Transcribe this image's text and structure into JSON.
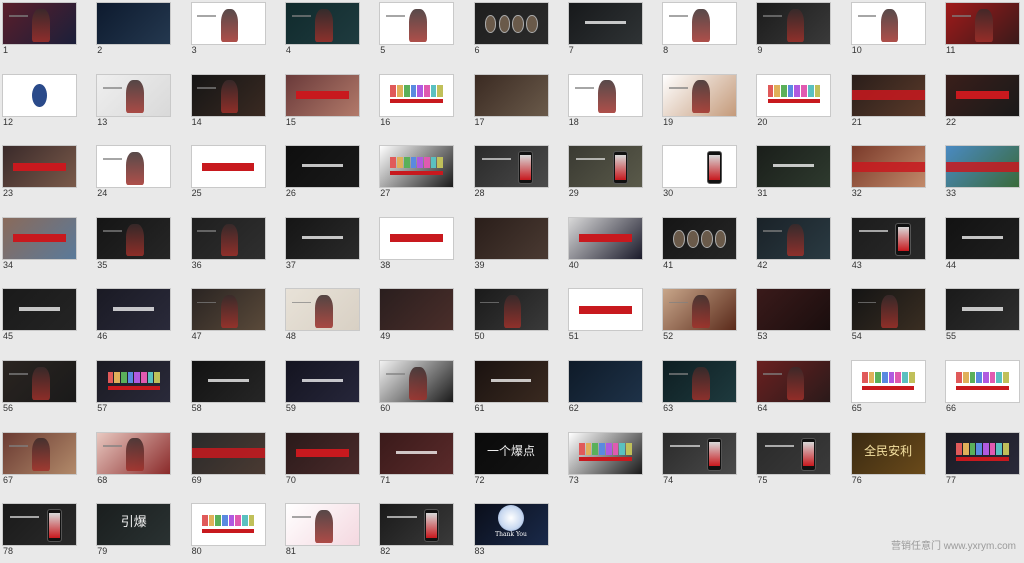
{
  "watermark": "营销任意门 www.yxrym.com",
  "slides": [
    {
      "n": "1",
      "c1": "#5a1e2a",
      "c2": "#1b1f3a",
      "ov": "figure"
    },
    {
      "n": "2",
      "c1": "#0d1a2e",
      "c2": "#24384f",
      "ov": "none"
    },
    {
      "n": "3",
      "c1": "#ffffff",
      "c2": "#ffffff",
      "ov": "figure"
    },
    {
      "n": "4",
      "c1": "#102a2c",
      "c2": "#1f3b3f",
      "ov": "figure"
    },
    {
      "n": "5",
      "c1": "#ffffff",
      "c2": "#ffffff",
      "ov": "figure"
    },
    {
      "n": "6",
      "c1": "#1e1e1e",
      "c2": "#2b2b2b",
      "ov": "circles"
    },
    {
      "n": "7",
      "c1": "#17191b",
      "c2": "#2f3335",
      "ov": "title"
    },
    {
      "n": "8",
      "c1": "#ffffff",
      "c2": "#ffffff",
      "ov": "figure"
    },
    {
      "n": "9",
      "c1": "#1b1b1b",
      "c2": "#3a3a3a",
      "ov": "figure"
    },
    {
      "n": "10",
      "c1": "#ffffff",
      "c2": "#ffffff",
      "ov": "figure"
    },
    {
      "n": "11",
      "c1": "#a01a1a",
      "c2": "#3a1a1a",
      "ov": "figure"
    },
    {
      "n": "12",
      "c1": "#ffffff",
      "c2": "#ffffff",
      "ov": "badge"
    },
    {
      "n": "13",
      "c1": "#efefef",
      "c2": "#d9d9d9",
      "ov": "figure"
    },
    {
      "n": "14",
      "c1": "#151515",
      "c2": "#3a2a22",
      "ov": "figure"
    },
    {
      "n": "15",
      "c1": "#6a3a3a",
      "c2": "#b27a6a",
      "ov": "bar"
    },
    {
      "n": "16",
      "c1": "#ffffff",
      "c2": "#ffffff",
      "ov": "row"
    },
    {
      "n": "17",
      "c1": "#3a2a22",
      "c2": "#6a5a4a",
      "ov": "none"
    },
    {
      "n": "18",
      "c1": "#ffffff",
      "c2": "#ffffff",
      "ov": "figure"
    },
    {
      "n": "19",
      "c1": "#ffffff",
      "c2": "#c49a7a",
      "ov": "figure"
    },
    {
      "n": "20",
      "c1": "#ffffff",
      "c2": "#ffffff",
      "ov": "row"
    },
    {
      "n": "21",
      "c1": "#2a1e1a",
      "c2": "#5a3a2a",
      "ov": "strip"
    },
    {
      "n": "22",
      "c1": "#3a1e1a",
      "c2": "#1a1a1a",
      "ov": "bar"
    },
    {
      "n": "23",
      "c1": "#3a2a2a",
      "c2": "#7a5a4a",
      "ov": "bar"
    },
    {
      "n": "24",
      "c1": "#ffffff",
      "c2": "#ffffff",
      "ov": "figure"
    },
    {
      "n": "25",
      "c1": "#ffffff",
      "c2": "#ffffff",
      "ov": "bar"
    },
    {
      "n": "26",
      "c1": "#0e0e0e",
      "c2": "#1a1a1a",
      "ov": "title"
    },
    {
      "n": "27",
      "c1": "#ffffff",
      "c2": "#1a1a1a",
      "ov": "row"
    },
    {
      "n": "28",
      "c1": "#2a2a2a",
      "c2": "#4a4a4a",
      "ov": "phone"
    },
    {
      "n": "29",
      "c1": "#3a3a32",
      "c2": "#5a5a4a",
      "ov": "phone"
    },
    {
      "n": "30",
      "c1": "#ffffff",
      "c2": "#ffffff",
      "ov": "phone"
    },
    {
      "n": "31",
      "c1": "#1a1e1a",
      "c2": "#2e3a2e",
      "ov": "title"
    },
    {
      "n": "32",
      "c1": "#7a3a2a",
      "c2": "#c28a6a",
      "ov": "strip"
    },
    {
      "n": "33",
      "c1": "#4a8ac2",
      "c2": "#3a6a3a",
      "ov": "strip"
    },
    {
      "n": "34",
      "c1": "#8a6a5a",
      "c2": "#5a7a9a",
      "ov": "bar"
    },
    {
      "n": "35",
      "c1": "#151515",
      "c2": "#262626",
      "ov": "figure"
    },
    {
      "n": "36",
      "c1": "#1f1f1f",
      "c2": "#2f2f2f",
      "ov": "figure"
    },
    {
      "n": "37",
      "c1": "#151515",
      "c2": "#2a2a2a",
      "ov": "title"
    },
    {
      "n": "38",
      "c1": "#ffffff",
      "c2": "#ffffff",
      "ov": "bar"
    },
    {
      "n": "39",
      "c1": "#2a1e1a",
      "c2": "#4a3a32",
      "ov": "none"
    },
    {
      "n": "40",
      "c1": "#d8d8d8",
      "c2": "#1a1a2a",
      "ov": "bar"
    },
    {
      "n": "41",
      "c1": "#151515",
      "c2": "#262626",
      "ov": "circles"
    },
    {
      "n": "42",
      "c1": "#1a2228",
      "c2": "#2a3a42",
      "ov": "figure"
    },
    {
      "n": "43",
      "c1": "#1c1c1c",
      "c2": "#2a2a2a",
      "ov": "phone"
    },
    {
      "n": "44",
      "c1": "#121212",
      "c2": "#1f1f1f",
      "ov": "title"
    },
    {
      "n": "45",
      "c1": "#1a1a1a",
      "c2": "#242424",
      "ov": "title"
    },
    {
      "n": "46",
      "c1": "#1a1a24",
      "c2": "#2a2a3a",
      "ov": "title"
    },
    {
      "n": "47",
      "c1": "#2a2422",
      "c2": "#5a4a3a",
      "ov": "figure"
    },
    {
      "n": "48",
      "c1": "#e8e2d8",
      "c2": "#d8d0c4",
      "ov": "figure"
    },
    {
      "n": "49",
      "c1": "#2a1e1e",
      "c2": "#4a2e2a",
      "ov": "none"
    },
    {
      "n": "50",
      "c1": "#1a1a1a",
      "c2": "#3a3a3a",
      "ov": "figure"
    },
    {
      "n": "51",
      "c1": "#ffffff",
      "c2": "#ffffff",
      "ov": "bar"
    },
    {
      "n": "52",
      "c1": "#c8a68a",
      "c2": "#5a2a1a",
      "ov": "figure"
    },
    {
      "n": "53",
      "c1": "#3a1a1a",
      "c2": "#1a0e0e",
      "ov": "none"
    },
    {
      "n": "54",
      "c1": "#141414",
      "c2": "#3a2e22",
      "ov": "figure"
    },
    {
      "n": "55",
      "c1": "#1a1a1a",
      "c2": "#2e2e2e",
      "ov": "title"
    },
    {
      "n": "56",
      "c1": "#2a2420",
      "c2": "#1a1a1a",
      "ov": "figure"
    },
    {
      "n": "57",
      "c1": "#1a1a22",
      "c2": "#2a2a3a",
      "ov": "row"
    },
    {
      "n": "58",
      "c1": "#121212",
      "c2": "#262626",
      "ov": "title"
    },
    {
      "n": "59",
      "c1": "#141420",
      "c2": "#26263a",
      "ov": "title"
    },
    {
      "n": "60",
      "c1": "#f2f2f2",
      "c2": "#1a1a1a",
      "ov": "figure"
    },
    {
      "n": "61",
      "c1": "#1a1210",
      "c2": "#3a2a20",
      "ov": "title"
    },
    {
      "n": "62",
      "c1": "#0e1a28",
      "c2": "#1e3248",
      "ov": "none"
    },
    {
      "n": "63",
      "c1": "#0e1e22",
      "c2": "#1e3a3e",
      "ov": "figure"
    },
    {
      "n": "64",
      "c1": "#6a2020",
      "c2": "#2a1a1a",
      "ov": "figure"
    },
    {
      "n": "65",
      "c1": "#ffffff",
      "c2": "#ffffff",
      "ov": "row"
    },
    {
      "n": "66",
      "c1": "#ffffff",
      "c2": "#ffffff",
      "ov": "row"
    },
    {
      "n": "67",
      "c1": "#6a3a32",
      "c2": "#b28a6a",
      "ov": "figure"
    },
    {
      "n": "68",
      "c1": "#e8c8c0",
      "c2": "#8a2a2a",
      "ov": "figure"
    },
    {
      "n": "69",
      "c1": "#2a2a2a",
      "c2": "#4a3a32",
      "ov": "strip"
    },
    {
      "n": "70",
      "c1": "#2a1a1a",
      "c2": "#4a2a2a",
      "ov": "bar"
    },
    {
      "n": "71",
      "c1": "#3a1a1a",
      "c2": "#5a2a2a",
      "ov": "title"
    },
    {
      "n": "72",
      "c1": "#0a0a0a",
      "c2": "#141414",
      "ov": "big72"
    },
    {
      "n": "73",
      "c1": "#ffffff",
      "c2": "#1a1a1a",
      "ov": "row"
    },
    {
      "n": "74",
      "c1": "#2a2a2a",
      "c2": "#4a4a4a",
      "ov": "phone"
    },
    {
      "n": "75",
      "c1": "#2a2a2a",
      "c2": "#3a3a3a",
      "ov": "phone"
    },
    {
      "n": "76",
      "c1": "#3a2a12",
      "c2": "#6a4a1a",
      "ov": "big76"
    },
    {
      "n": "77",
      "c1": "#1a1a22",
      "c2": "#2a2a3a",
      "ov": "row"
    },
    {
      "n": "78",
      "c1": "#1a1a1a",
      "c2": "#2a2a2a",
      "ov": "phone"
    },
    {
      "n": "79",
      "c1": "#1a1e1e",
      "c2": "#2a3232",
      "ov": "big79"
    },
    {
      "n": "80",
      "c1": "#ffffff",
      "c2": "#ffffff",
      "ov": "row"
    },
    {
      "n": "81",
      "c1": "#ffffff",
      "c2": "#f4d8e0",
      "ov": "figure"
    },
    {
      "n": "82",
      "c1": "#1a1a1a",
      "c2": "#3a3a3a",
      "ov": "phone"
    },
    {
      "n": "83",
      "c1": "#0a0e1a",
      "c2": "#1a2a4a",
      "ov": "moon"
    }
  ],
  "slide_text": {
    "big72": "一个爆点",
    "big76": "全民安利",
    "big79": "引爆",
    "thanks": "Thank You"
  },
  "colors": {
    "accent_red": "#c8191e",
    "page_bg": "#e9e9e9",
    "thumb_border": "#c9c9c9"
  }
}
